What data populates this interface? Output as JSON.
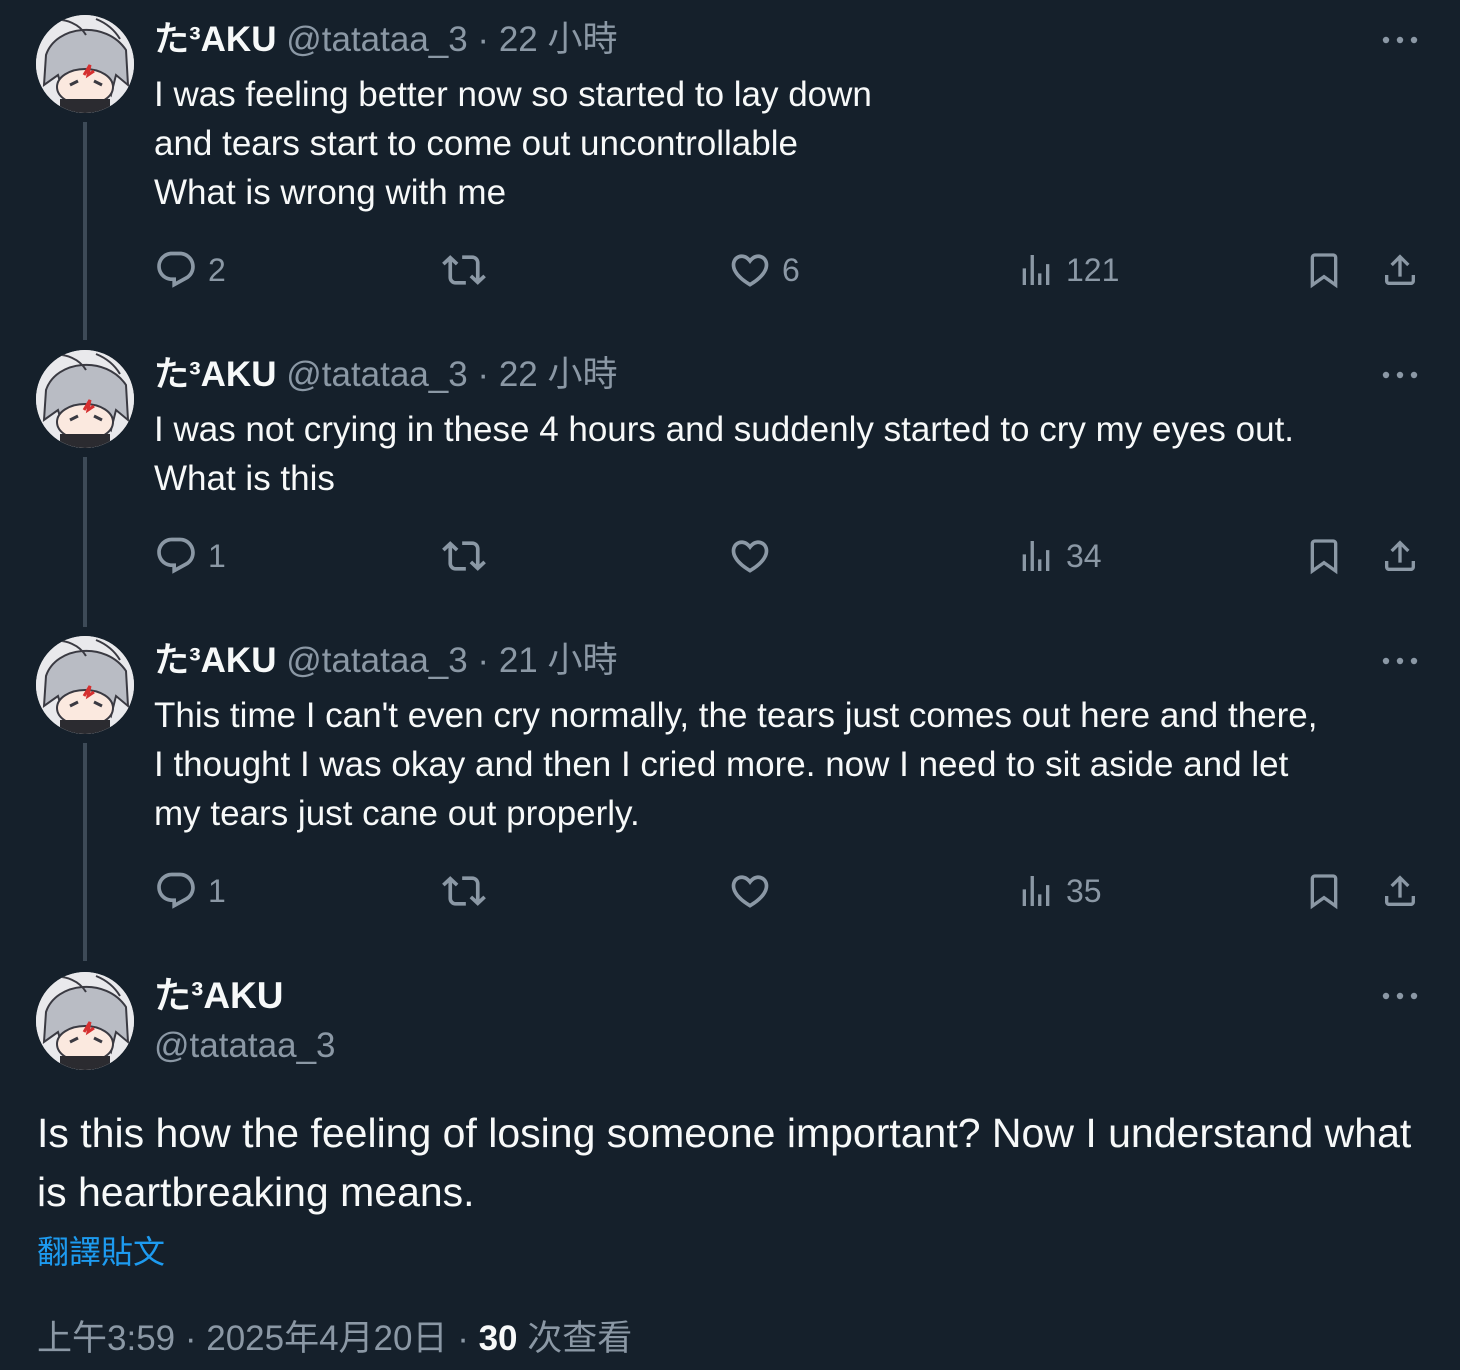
{
  "user": {
    "display_name": "た³AKU",
    "handle": "@tatataa_3",
    "avatar_icon": "anime-avatar-icon"
  },
  "colors": {
    "background": "#15202b",
    "text": "#f7f9f9",
    "muted": "#8b98a5",
    "accent": "#1d9bf0",
    "thread_line": "#3d4a57"
  },
  "tweets": [
    {
      "meta": "@tatataa_3 · 22 小時",
      "text": "I was feeling better now so started to lay down\nand tears start to come out uncontrollable\nWhat is wrong with me",
      "replies": "2",
      "retweets": "",
      "likes": "6",
      "views": "121"
    },
    {
      "meta": "@tatataa_3 · 22 小時",
      "text": "I was not crying in these 4 hours and suddenly started to cry my eyes out.\nWhat is this",
      "replies": "1",
      "retweets": "",
      "likes": "",
      "views": "34"
    },
    {
      "meta": "@tatataa_3 · 21 小時",
      "text": "This time I can't even cry normally, the tears just comes out here and there,\nI thought I was okay and then I cried more. now I need to sit aside and let\nmy tears just cane out properly.",
      "replies": "1",
      "retweets": "",
      "likes": "",
      "views": "35"
    }
  ],
  "main_tweet": {
    "text": "Is this how the feeling of losing someone important? Now I understand what is heartbreaking means.",
    "translate_label": "翻譯貼文",
    "timestamp": "上午3:59 · 2025年4月20日 · ",
    "views_count": "30",
    "views_label": " 次查看"
  },
  "icons": {
    "reply": "reply-icon",
    "retweet": "retweet-icon",
    "like": "heart-icon",
    "views": "views-chart-icon",
    "bookmark": "bookmark-icon",
    "share": "share-icon",
    "more": "more-dots-icon"
  }
}
